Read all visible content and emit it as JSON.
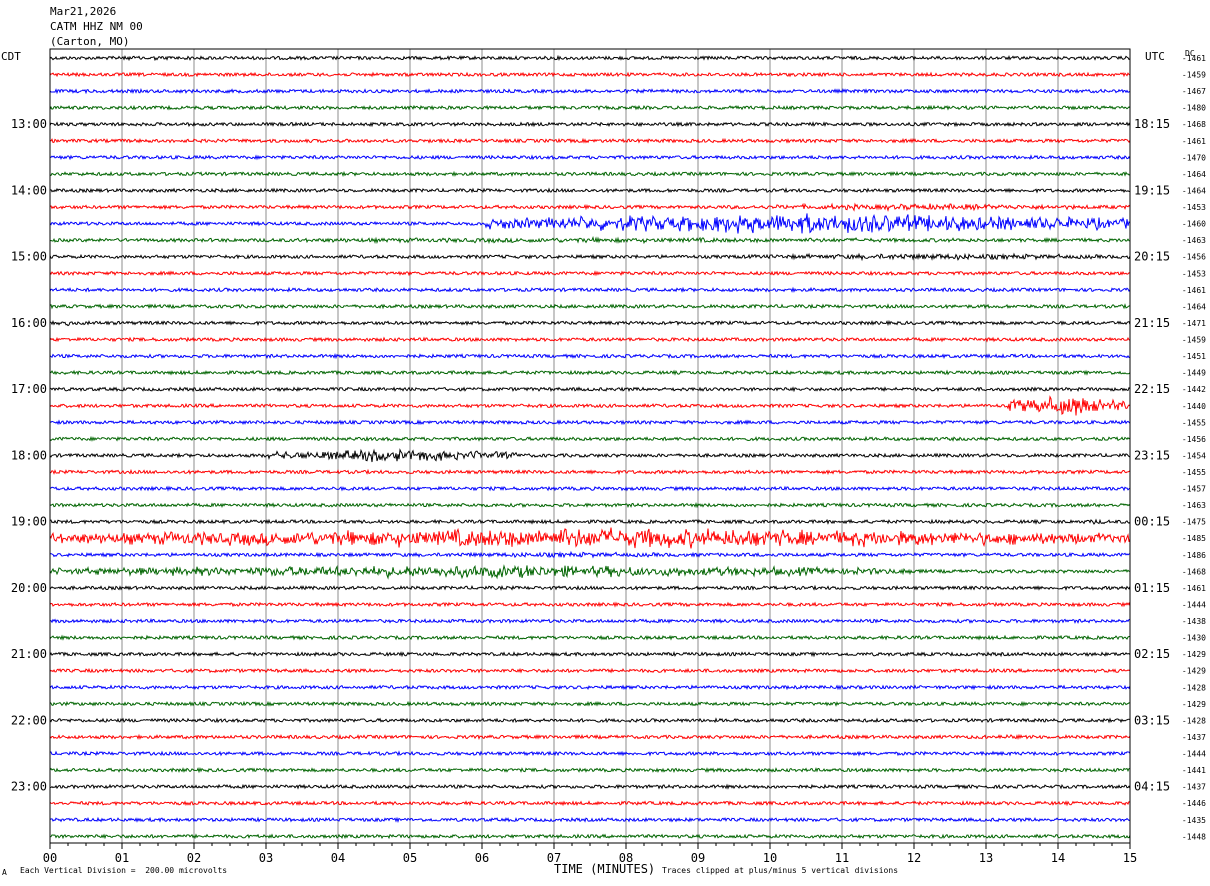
{
  "header": {
    "date": "Mar21,2026",
    "station": "CATM HHZ NM 00",
    "location": "(Carton, MO)"
  },
  "axes": {
    "left_timezone": "CDT",
    "right_timezone": "UTC",
    "dc_label": "DC",
    "x_label": "TIME (MINUTES)",
    "x_ticks": [
      "00",
      "01",
      "02",
      "03",
      "04",
      "05",
      "06",
      "07",
      "08",
      "09",
      "10",
      "11",
      "12",
      "13",
      "14",
      "15"
    ]
  },
  "footer": {
    "division_note": "Each Vertical Division =  200.00 microvolts",
    "clip_note": "Traces clipped at plus/minus 5 vertical divisions",
    "corner_mark": "А"
  },
  "colors": {
    "trace_cycle": [
      "#000000",
      "#ff0000",
      "#0000ff",
      "#006400"
    ],
    "grid": "#8c8c8c",
    "frame": "#000000"
  },
  "chart_data": {
    "type": "line",
    "title": "",
    "xlabel": "TIME (MINUTES)",
    "xlim": [
      0,
      15
    ],
    "traces_per_hour": 4,
    "left_hour_labels": [
      "13:00",
      "14:00",
      "15:00",
      "16:00",
      "17:00",
      "18:00",
      "19:00",
      "20:00",
      "21:00",
      "22:00",
      "23:00"
    ],
    "right_hour_labels": [
      "18:15",
      "19:15",
      "20:15",
      "21:15",
      "22:15",
      "23:15",
      "00:15",
      "01:15",
      "02:15",
      "03:15",
      "04:15"
    ],
    "dc_offsets": [
      -1461,
      -1459,
      -1467,
      -1480,
      -1468,
      -1461,
      -1470,
      -1464,
      -1464,
      -1453,
      -1460,
      -1463,
      -1456,
      -1453,
      -1461,
      -1464,
      -1471,
      -1459,
      -1451,
      -1449,
      -1442,
      -1440,
      -1455,
      -1456,
      -1454,
      -1455,
      -1457,
      -1463,
      -1475,
      -1485,
      -1486,
      -1468,
      -1461,
      -1444,
      -1438,
      -1430,
      -1429,
      -1429,
      -1428,
      -1429,
      -1428,
      -1437,
      -1444,
      -1441,
      -1437,
      -1446,
      -1435,
      -1448
    ],
    "events": [
      {
        "trace": 0,
        "start_min": 0.9,
        "end_min": 2.1,
        "amplitude": 2
      },
      {
        "trace": 10,
        "start_min": 6.0,
        "end_min": 15.0,
        "amplitude": 8
      },
      {
        "trace": 9,
        "start_min": 9.0,
        "end_min": 15.0,
        "amplitude": 2.5
      },
      {
        "trace": 11,
        "start_min": 0.0,
        "end_min": 15.0,
        "amplitude": 2
      },
      {
        "trace": 12,
        "start_min": 9.5,
        "end_min": 15.0,
        "amplitude": 2.5
      },
      {
        "trace": 16,
        "start_min": 0.0,
        "end_min": 0.5,
        "amplitude": 2
      },
      {
        "trace": 21,
        "start_min": 13.3,
        "end_min": 15.0,
        "amplitude": 8
      },
      {
        "trace": 24,
        "start_min": 3.0,
        "end_min": 6.5,
        "amplitude": 5
      },
      {
        "trace": 29,
        "start_min": 0.0,
        "end_min": 15.0,
        "amplitude": 8
      },
      {
        "trace": 31,
        "start_min": 0.0,
        "end_min": 12.0,
        "amplitude": 5
      },
      {
        "trace": 30,
        "start_min": 4.0,
        "end_min": 10.0,
        "amplitude": 2
      },
      {
        "trace": 28,
        "start_min": 14.0,
        "end_min": 15.0,
        "amplitude": 2
      },
      {
        "trace": 41,
        "start_min": 12.8,
        "end_min": 13.8,
        "amplitude": 1.5
      }
    ]
  }
}
